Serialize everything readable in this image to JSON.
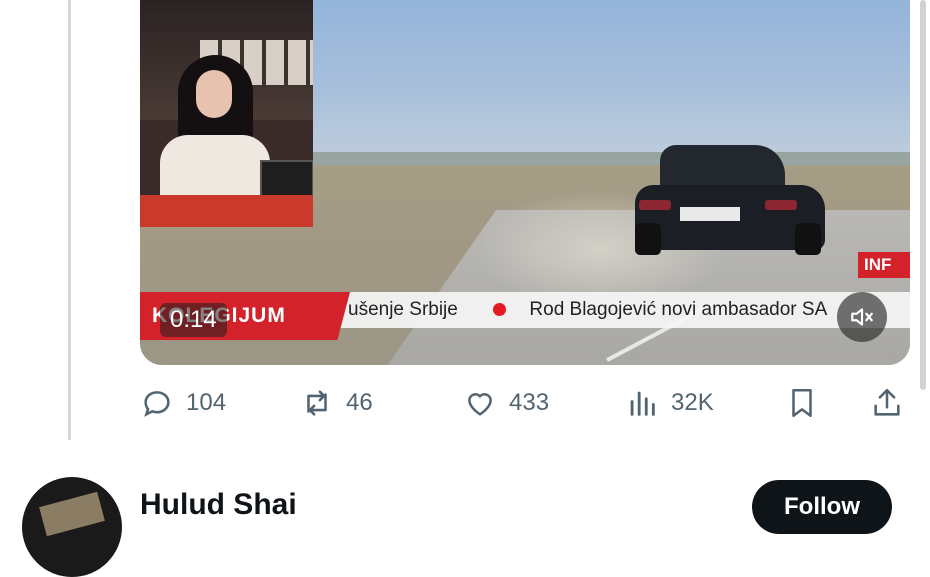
{
  "video": {
    "time": "0:14",
    "logo_text": "KOLEGIJUM",
    "ticker_left": "ušenje Srbije",
    "ticker_right": "Rod Blagojević novi ambasador SA",
    "badge": "INF",
    "mute_icon": "speaker-muted-icon"
  },
  "actions": {
    "replies": "104",
    "reposts": "46",
    "likes": "433",
    "views": "32K"
  },
  "next_tweet": {
    "author_name": "Hulud Shai",
    "follow_label": "Follow"
  },
  "colors": {
    "action_gray": "#536471",
    "follow_bg": "#0f1419",
    "ticker_red": "#d4222a"
  }
}
